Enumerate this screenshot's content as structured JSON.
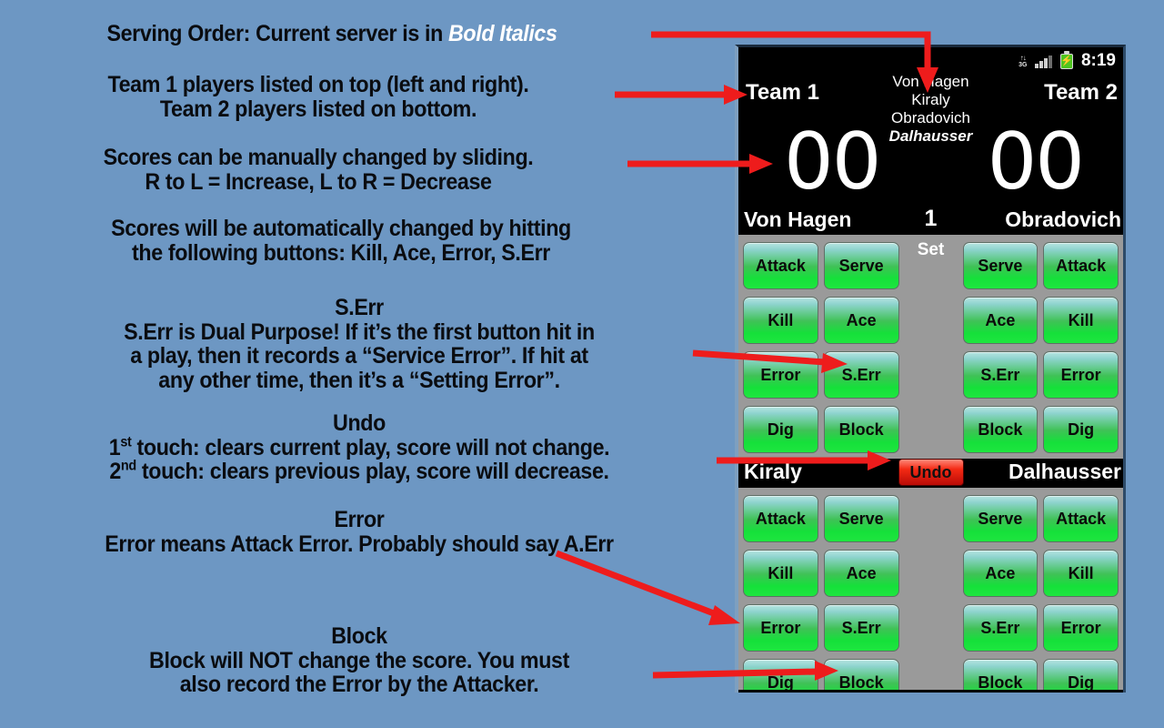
{
  "background_color": "#6d97c3",
  "annotations": [
    {
      "id": "note-serving",
      "prefix": "Serving Order: Current server is in ",
      "emphasis": "Bold Italics",
      "lines": []
    },
    {
      "id": "note-teams",
      "lines": [
        "Team 1 players listed on top (left and right).",
        "Team 2 players listed on bottom."
      ]
    },
    {
      "id": "note-manual",
      "lines": [
        "Scores can be manually changed by sliding.",
        "R to L = Increase, L to R = Decrease"
      ]
    },
    {
      "id": "note-auto",
      "lines": [
        "Scores will be automatically changed by hitting",
        "the following buttons: Kill, Ace, Error, S.Err"
      ]
    },
    {
      "id": "note-serr",
      "heading": "S.Err",
      "lines": [
        "S.Err is Dual Purpose!  If it’s the first button hit in",
        "a play, then it records a “Service Error”.  If hit at",
        "any other time, then it’s a “Setting Error”."
      ]
    },
    {
      "id": "note-undo",
      "heading": "Undo",
      "lines": [
        "1st touch: clears current play, score will not change.",
        "2nd touch: clears previous play, score will decrease."
      ]
    },
    {
      "id": "note-error",
      "heading": "Error",
      "lines": [
        "Error means Attack Error.  Probably should say A.Err"
      ]
    },
    {
      "id": "note-block",
      "heading": "Block",
      "lines": [
        "Block will NOT change the score.  You must",
        "also record the Error by the Attacker."
      ]
    }
  ],
  "annotation_text": {
    "serving_prefix": "Serving Order: Current server is in ",
    "serving_emphasis": "Bold Italics",
    "teams_line1": "Team 1 players listed on top (left and right).",
    "teams_line2": "Team 2 players listed on bottom.",
    "manual_line1": "Scores can be manually changed by sliding.",
    "manual_line2": "R to L = Increase, L to R = Decrease",
    "auto_line1": "Scores will be automatically changed by hitting",
    "auto_line2": "the following buttons: Kill, Ace, Error, S.Err",
    "serr_heading": "S.Err",
    "serr_line1": "S.Err is Dual Purpose!  If it’s the first button hit in",
    "serr_line2": "a play, then it records a “Service Error”.  If hit at",
    "serr_line3": "any other time, then it’s a “Setting Error”.",
    "undo_heading": "Undo",
    "undo_line1_ord": "1",
    "undo_line1_sup": "st",
    "undo_line1_rest": " touch: clears current play, score will not change.",
    "undo_line2_ord": "2",
    "undo_line2_sup": "nd",
    "undo_line2_rest": " touch: clears previous play, score will decrease.",
    "error_heading": "Error",
    "error_line1": "Error means Attack Error.  Probably should say A.Err",
    "block_heading": "Block",
    "block_line1": "Block will NOT change the score.  You must",
    "block_line2": "also record the Error by the Attacker."
  },
  "arrow_color": "#ee1c1c",
  "phone": {
    "status_bar": {
      "network_label": "3G",
      "network_arrows": "↑↓",
      "time": "8:19",
      "battery_glyph": "⚡",
      "signal_bars": 4
    },
    "team1_label": "Team 1",
    "team2_label": "Team 2",
    "serving_order": [
      "Von Hagen",
      "Kiraly",
      "Obradovich",
      "Dalhausser"
    ],
    "current_server": "Dalhausser",
    "score_team1": "00",
    "score_team2": "00",
    "set_label": "Set",
    "set_number": "1",
    "top_row": {
      "left_player": "Von Hagen",
      "right_player": "Obradovich"
    },
    "bottom_row": {
      "left_player": "Kiraly",
      "right_player": "Dalhausser"
    },
    "undo_label": "Undo",
    "button_grid_top": [
      [
        "Attack",
        "Serve",
        "Serve",
        "Attack"
      ],
      [
        "Kill",
        "Ace",
        "Ace",
        "Kill"
      ],
      [
        "Error",
        "S.Err",
        "S.Err",
        "Error"
      ],
      [
        "Dig",
        "Block",
        "Block",
        "Dig"
      ]
    ],
    "button_grid_bottom": [
      [
        "Attack",
        "Serve",
        "Serve",
        "Attack"
      ],
      [
        "Kill",
        "Ace",
        "Ace",
        "Kill"
      ],
      [
        "Error",
        "S.Err",
        "S.Err",
        "Error"
      ],
      [
        "Dig",
        "Block",
        "Block",
        "Dig"
      ]
    ],
    "colors": {
      "screen_bg": "#000000",
      "grid_bg": "#9a9a9a",
      "button_green": "#15e03a",
      "button_top_tint": "#b7e4e0",
      "undo_red": "#f42a14",
      "text_white": "#ffffff"
    }
  }
}
